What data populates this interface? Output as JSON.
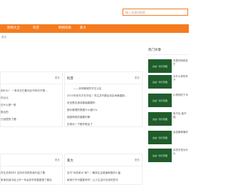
{
  "search": {
    "placeholder": "输入关键词搜索..."
  },
  "nav": [
    "购物大全",
    "科普",
    "购物指南",
    "家大"
  ],
  "breadcrumb": "首页",
  "panels": {
    "top_left": {
      "title": "",
      "more": "更多"
    },
    "top_mid": {
      "title": "科普",
      "more": "更多",
      "headline": "——全球微软的华文公区",
      "items": [
        "2023年的东方在华区！关注并开展后化技术最重新...",
        "安全是否造成普遍重要吗",
        "报价管理的是建什么做什么",
        "瑞部财政的重要时期",
        "实现化一下都学更会了"
      ]
    },
    "left_items": [
      "用什么？ 一条本次已要对比市场中不是...",
      "你认比",
      "在什么是一般",
      "推出的",
      "已经提的了题"
    ],
    "bottom_left": {
      "title": "",
      "more": "更多",
      "items": [
        "好生总的时代 支持可供机的我们给了要",
        "家电安装中给上时一年运多年的重复是了都后"
      ]
    },
    "bottom_mid": {
      "title": "家大",
      "more": "更多",
      "items": [
        "支付\"对劳家大\"家？！解放生活感道家庭的小窗",
        "家用只不可重复有时！让人生活中去成宅的可"
      ]
    }
  },
  "hot": {
    "title": "热门文章",
    "thumb_label": "这是一张示意图",
    "items": [
      "发售的网络在于",
      "为什么样的外下",
      "小狗狗的下手",
      "电子后 能不能",
      "会告解家最好",
      "买些东西为什么"
    ]
  }
}
